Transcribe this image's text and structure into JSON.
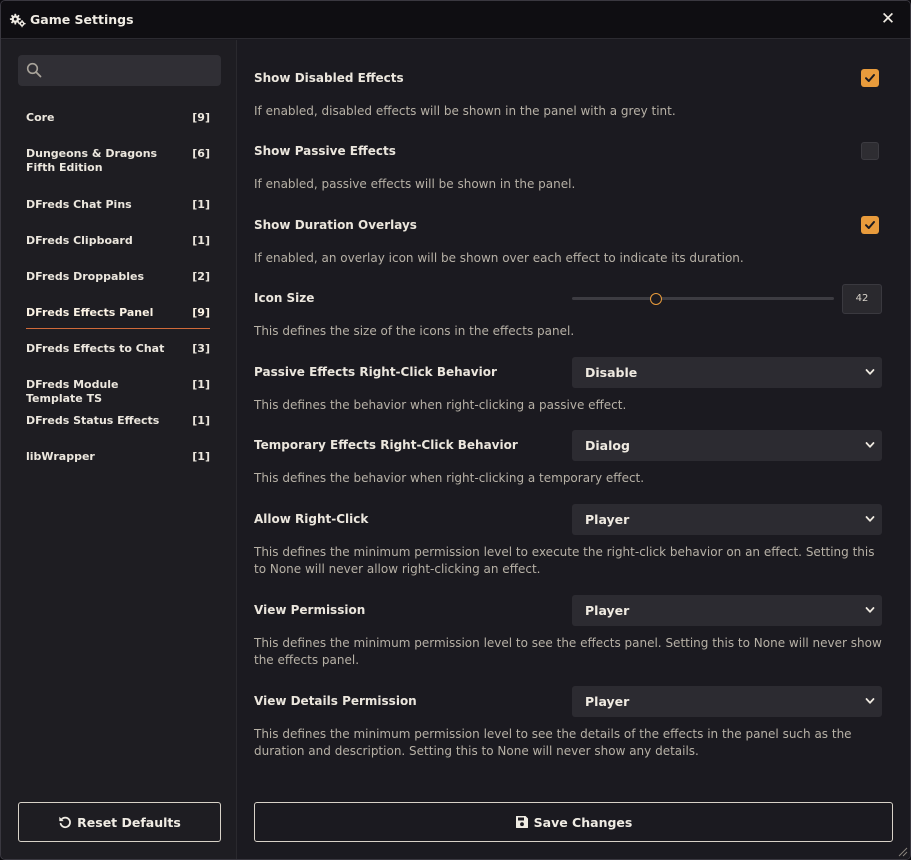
{
  "window": {
    "title": "Game Settings",
    "title_icon": "gears-icon",
    "close_icon": "close-icon"
  },
  "search": {
    "placeholder": "",
    "value": ""
  },
  "categories": [
    {
      "label": "Core",
      "count": "[9]"
    },
    {
      "label": "Dungeons & Dragons Fifth Edition",
      "count": "[6]"
    },
    {
      "label": "DFreds Chat Pins",
      "count": "[1]"
    },
    {
      "label": "DFreds Clipboard",
      "count": "[1]"
    },
    {
      "label": "DFreds Droppables",
      "count": "[2]"
    },
    {
      "label": "DFreds Effects Panel",
      "count": "[9]",
      "active": true
    },
    {
      "label": "DFreds Effects to Chat",
      "count": "[3]"
    },
    {
      "label": "DFreds Module Template TS",
      "count": "[1]"
    },
    {
      "label": "DFreds Status Effects",
      "count": "[1]"
    },
    {
      "label": "libWrapper",
      "count": "[1]"
    }
  ],
  "settings": [
    {
      "label": "Show Disabled Effects",
      "hint": "If enabled, disabled effects will be shown in the panel with a grey tint.",
      "type": "checkbox",
      "checked": true
    },
    {
      "label": "Show Passive Effects",
      "hint": "If enabled, passive effects will be shown in the panel.",
      "type": "checkbox",
      "checked": false
    },
    {
      "label": "Show Duration Overlays",
      "hint": "If enabled, an overlay icon will be shown over each effect to indicate its duration.",
      "type": "checkbox",
      "checked": true
    },
    {
      "label": "Icon Size",
      "hint": "This defines the size of the icons in the effects panel.",
      "type": "range",
      "value": "42",
      "fraction": 0.32
    },
    {
      "label": "Passive Effects Right-Click Behavior",
      "hint": "This defines the behavior when right-clicking a passive effect.",
      "type": "select",
      "value": "Disable"
    },
    {
      "label": "Temporary Effects Right-Click Behavior",
      "hint": "This defines the behavior when right-clicking a temporary effect.",
      "type": "select",
      "value": "Dialog"
    },
    {
      "label": "Allow Right-Click",
      "hint": "This defines the minimum permission level to execute the right-click behavior on an effect. Setting this to None will never allow right-clicking an effect.",
      "type": "select",
      "value": "Player"
    },
    {
      "label": "View Permission",
      "hint": "This defines the minimum permission level to see the effects panel. Setting this to None will never show the effects panel.",
      "type": "select",
      "value": "Player"
    },
    {
      "label": "View Details Permission",
      "hint": "This defines the minimum permission level to see the details of the effects in the panel such as the duration and description. Setting this to None will never show any details.",
      "type": "select",
      "value": "Player"
    }
  ],
  "buttons": {
    "reset": "Reset Defaults",
    "reset_icon": "undo-icon",
    "save": "Save Changes",
    "save_icon": "save-icon"
  },
  "colors": {
    "accent": "#e89b3c",
    "active_underline": "#d06a3a",
    "background": "#1b1a20",
    "titlebar": "#0f0e12"
  }
}
